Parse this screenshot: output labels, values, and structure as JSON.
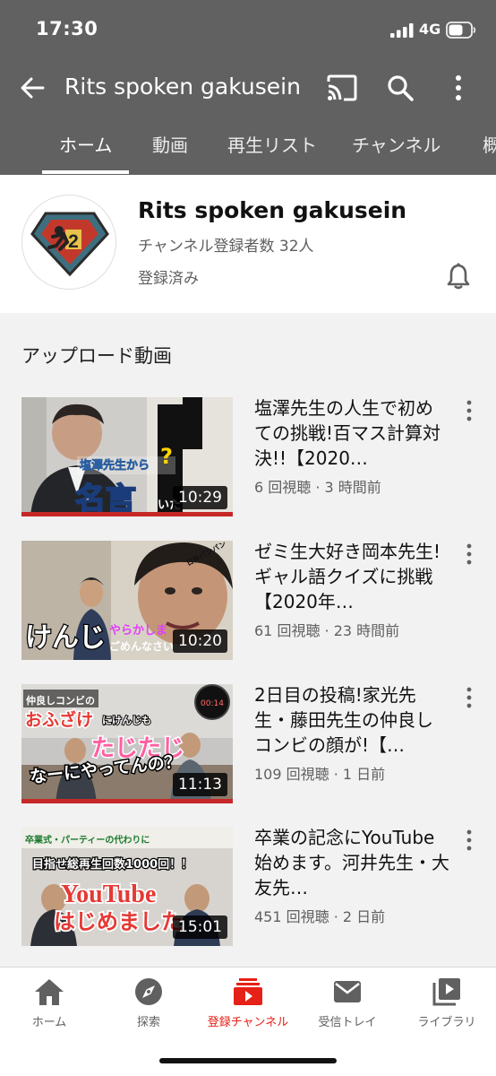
{
  "status_bar": {
    "time": "17:30",
    "network": "4G"
  },
  "app_bar": {
    "title": "Rits spoken gakusein"
  },
  "tabs": [
    {
      "label": "ホーム"
    },
    {
      "label": "動画"
    },
    {
      "label": "再生リスト"
    },
    {
      "label": "チャンネル"
    },
    {
      "label": "概"
    }
  ],
  "channel": {
    "name": "Rits spoken gakusein",
    "subscribers": "チャンネル登録者数 32人",
    "subscription_state": "登録済み",
    "avatar_badge": "2"
  },
  "uploads": {
    "heading": "アップロード動画",
    "videos": [
      {
        "title": "塩澤先生の人生で初めての挑戦!百マス計算対決!!【2020…",
        "meta": "6 回視聴 · 3 時間前",
        "duration": "10:29",
        "thumb_texts": [
          "塩澤先生から",
          "名言",
          "?",
          "いた"
        ]
      },
      {
        "title": "ゼミ生大好き岡本先生!ギャル語クイズに挑戦【2020年…",
        "meta": "61 回視聴 · 23 時間前",
        "duration": "10:20",
        "thumb_texts": [
          "けんじ",
          "やらかしま",
          "ごめんなさい",
          "日外パンパン"
        ]
      },
      {
        "title": "2日目の投稿!家光先生・藤田先生の仲良しコンビの顔が!【…",
        "meta": "109 回視聴 · 1 日前",
        "duration": "11:13",
        "thumb_texts": [
          "仲良しコンビの",
          "おふざけ",
          "にけんじも",
          "たじたじ",
          "なーにやってんの？",
          "00:14"
        ]
      },
      {
        "title": "卒業の記念にYouTube始めます。河井先生・大友先…",
        "meta": "451 回視聴 · 2 日前",
        "duration": "15:01",
        "thumb_texts": [
          "卒業式・パーティーの代わりに",
          "目指せ総再生回数1000回！！",
          "YouTube",
          "はじめました"
        ]
      }
    ]
  },
  "bottom_nav": [
    {
      "label": "ホーム",
      "icon": "home-icon"
    },
    {
      "label": "探索",
      "icon": "explore-icon"
    },
    {
      "label": "登録チャンネル",
      "icon": "subscriptions-icon",
      "active": true
    },
    {
      "label": "受信トレイ",
      "icon": "inbox-icon"
    },
    {
      "label": "ライブラリ",
      "icon": "library-icon"
    }
  ],
  "colors": {
    "header_bg": "#616161",
    "accent_red": "#e62117",
    "page_bg": "#f2f2f2"
  }
}
